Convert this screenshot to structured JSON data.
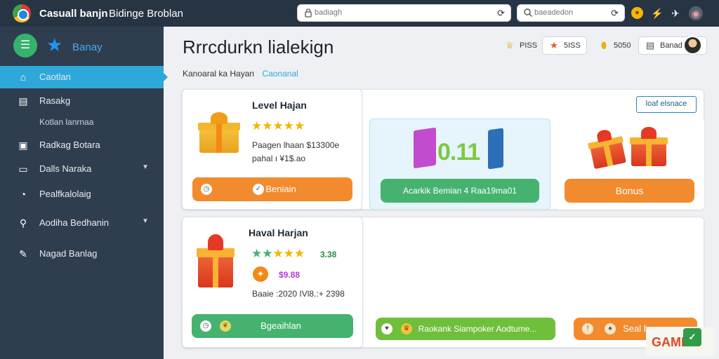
{
  "topbar": {
    "app_title": "Casuall banjn",
    "app_subtitle": "Bidinge Broblan",
    "search_primary_placeholder": "badiagh",
    "search_secondary_placeholder": "baeadedon"
  },
  "sidebar": {
    "brand_label": "Banay",
    "items": [
      {
        "label": "Caotlan"
      },
      {
        "label": "Rasakg"
      },
      {
        "label": "Kotlan lanrnaa"
      },
      {
        "label": "Radkag Botara"
      },
      {
        "label": "Dalls Naraka"
      },
      {
        "label": "Pealfkalolaig"
      },
      {
        "label": "Aodiha Bedhanin"
      },
      {
        "label": "Nagad Banlag"
      }
    ]
  },
  "header": {
    "title": "Rrrcdurkn lialekign",
    "breadcrumb_parent": "Kanoaral ka Hayan",
    "breadcrumb_current": "Caonanal",
    "stat_1": "PISS",
    "stat_2": "5ISS",
    "stat_3": "5050",
    "stat_4": "Banad"
  },
  "card_top": {
    "title": "Level Hajan",
    "rating": 5,
    "line_1": "Paagen lhaan  $13300e",
    "line_2": "pahal ı ¥1$.ao",
    "button_label": "Beniain",
    "outline_button": "loaf elsnace"
  },
  "score_panel": {
    "score_text": "0.11",
    "button_label": "Acarkik Bemian 4 Raa19ma01"
  },
  "bonus_panel": {
    "button_label": "Bonus"
  },
  "card_bottom": {
    "title": "Haval Harjan",
    "rating_value": "3.38",
    "price": "$9.88",
    "line": "Baaie :2020 IVl8.:+ 2398",
    "button_label": "Bgeaihlan",
    "green_button": "Raokank Siampoker Aodtume...",
    "orange_button": "Seal hamm"
  },
  "watermark": {
    "text": "GAME"
  },
  "colors": {
    "sidebar": "#2f3e4e",
    "topbar": "#273443",
    "accent": "#2ea8d8",
    "orange": "#f28a2e",
    "green": "#45b36f"
  }
}
